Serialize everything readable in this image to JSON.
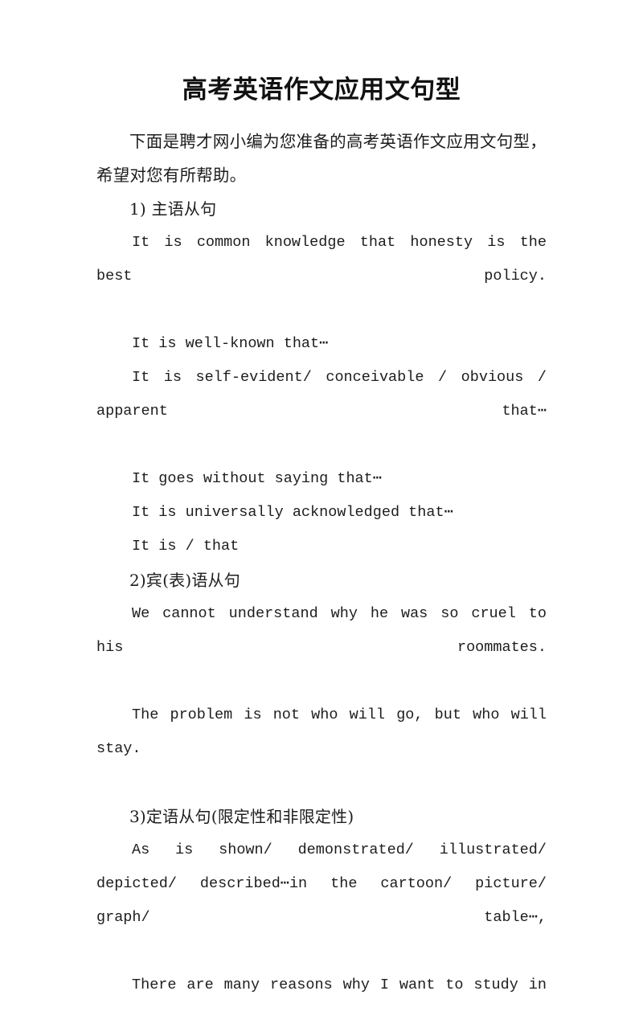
{
  "document": {
    "title": "高考英语作文应用文句型",
    "intro": "下面是聘才网小编为您准备的高考英语作文应用文句型，希望对您有所帮助。",
    "sections": [
      {
        "heading": "1) 主语从句",
        "lines": [
          "It is common knowledge that honesty is the best policy.",
          "It is well-known that⋯",
          "It is self-evident/ conceivable / obvious / apparent that⋯",
          "It goes without saying that⋯",
          "It is universally acknowledged that⋯",
          "It is / that"
        ]
      },
      {
        "heading": "2)宾(表)语从句",
        "lines": [
          "We cannot understand why he was so cruel to his roommates.",
          "The problem is not who will go, but who will stay."
        ]
      },
      {
        "heading": "3)定语从句(限定性和非限定性)",
        "lines": [
          "As is shown/ demonstrated/ illustrated/ depicted/ described⋯in the cartoon/ picture/ graph/ table⋯,",
          "There are many reasons why I want to study in"
        ]
      }
    ]
  },
  "colors": {
    "page_background": "#ffffff",
    "text": "#1a1a1a",
    "title_text": "#111111"
  }
}
